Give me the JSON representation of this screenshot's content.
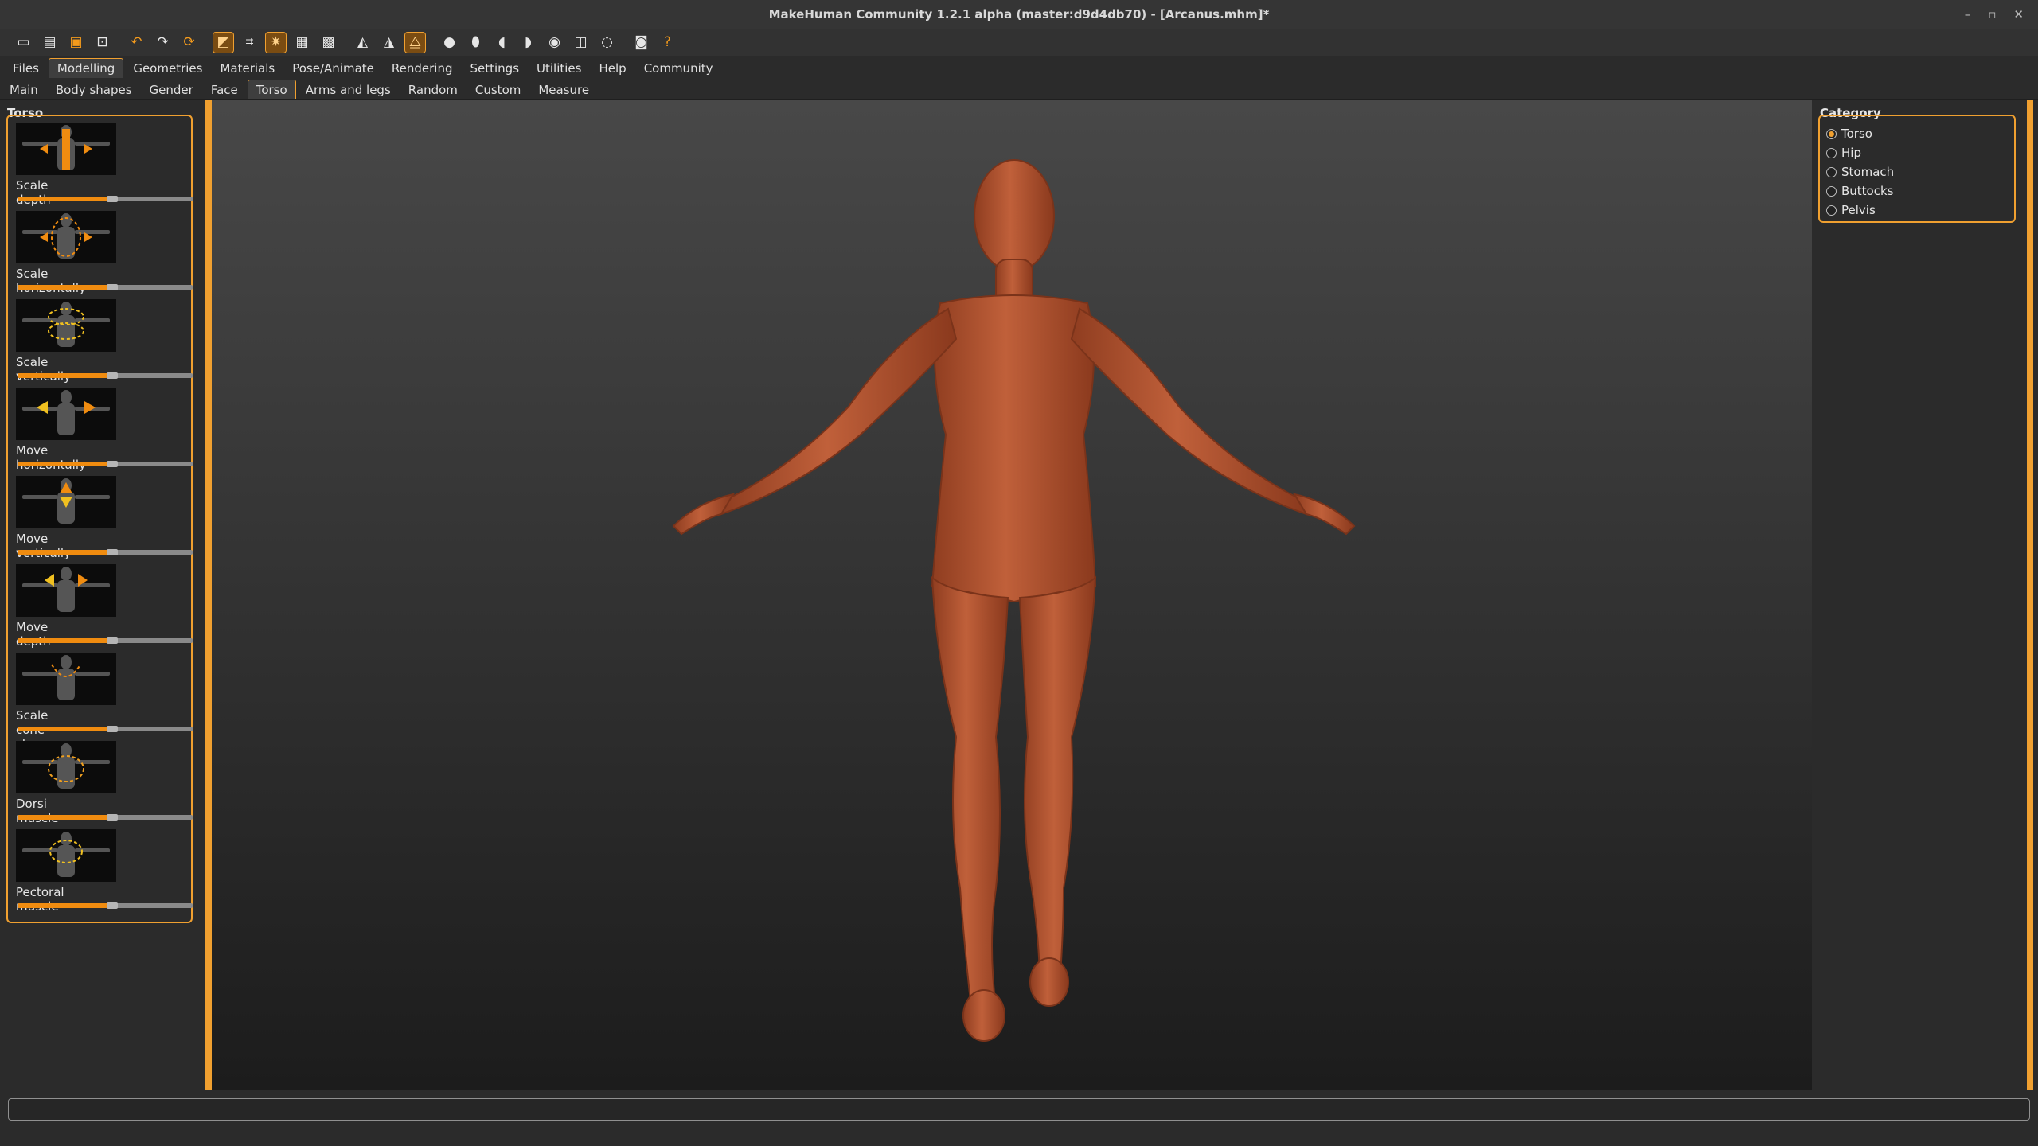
{
  "window": {
    "title": "MakeHuman Community 1.2.1 alpha (master:d9d4db70) - [Arcanus.mhm]*",
    "controls": [
      "minimize-icon",
      "maximize-icon",
      "close-icon"
    ]
  },
  "toolbar": {
    "groups": [
      [
        "new-icon",
        "save-icon",
        "load-icon",
        "export-icon"
      ],
      [
        "undo-icon",
        "redo-icon",
        "reset-icon"
      ],
      [
        "smooth-icon",
        "wireframe-icon",
        "background-icon",
        "grid-icon",
        "checker-icon"
      ],
      [
        "symmetry-right-icon",
        "symmetry-left-icon",
        "symmetry-icon"
      ],
      [
        "front-view-icon",
        "back-view-icon",
        "left-view-icon",
        "right-view-icon",
        "top-view-icon",
        "bottom-view-icon",
        "reset-camera-icon"
      ],
      [
        "screenshot-icon",
        "help-icon"
      ]
    ]
  },
  "main_tabs": [
    "Files",
    "Modelling",
    "Geometries",
    "Materials",
    "Pose/Animate",
    "Rendering",
    "Settings",
    "Utilities",
    "Help",
    "Community"
  ],
  "main_tab_active": "Modelling",
  "sub_tabs": [
    "Main",
    "Body shapes",
    "Gender",
    "Face",
    "Torso",
    "Arms and legs",
    "Random",
    "Custom",
    "Measure"
  ],
  "sub_tab_active": "Torso",
  "left_panel": {
    "title": "Torso",
    "sliders": [
      {
        "label": "Scale depth",
        "value": 0.5
      },
      {
        "label": "Scale horizontally",
        "value": 0.5
      },
      {
        "label": "Scale vertically",
        "value": 0.5
      },
      {
        "label": "Move horizontally",
        "value": 0.5
      },
      {
        "label": "Move vertically",
        "value": 0.5
      },
      {
        "label": "Move depth",
        "value": 0.5
      },
      {
        "label": "Scale cone-shape",
        "value": 0.5
      },
      {
        "label": "Dorsi muscle",
        "value": 0.5
      },
      {
        "label": "Pectoral muscle",
        "value": 0.5
      }
    ]
  },
  "right_panel": {
    "title": "Category",
    "options": [
      {
        "label": "Torso",
        "checked": true
      },
      {
        "label": "Hip",
        "checked": false
      },
      {
        "label": "Stomach",
        "checked": false
      },
      {
        "label": "Buttocks",
        "checked": false
      },
      {
        "label": "Pelvis",
        "checked": false
      }
    ]
  },
  "colors": {
    "accent": "#f0a030",
    "slider_fill": "#f08c10",
    "skin": "#b5532f",
    "background": "#2b2b2b"
  }
}
